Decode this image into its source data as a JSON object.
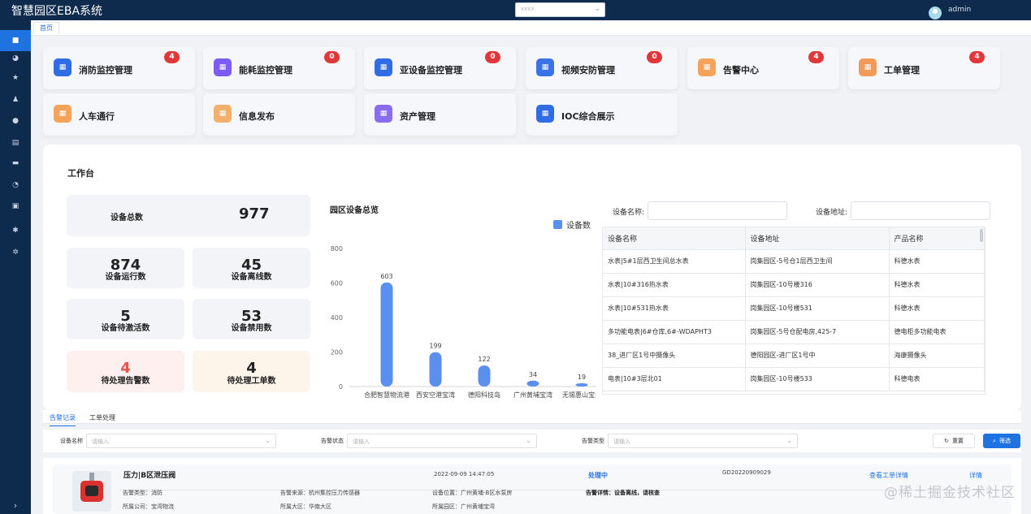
{
  "app": {
    "title": "智慧园区EBA系统",
    "project_select": {
      "placeholder": "xxxx"
    },
    "user": "admin"
  },
  "tabs": {
    "home": "首页"
  },
  "sidebar": {
    "items": [
      "dashboard",
      "monitor",
      "favorite",
      "user",
      "bell",
      "document",
      "print",
      "report",
      "module",
      "settings",
      "gear"
    ]
  },
  "modules": [
    {
      "label": "消防监控管理",
      "badge": "4",
      "color": "#2f6ce5",
      "icon": "fire-monitor-icon"
    },
    {
      "label": "能耗监控管理",
      "badge": "0",
      "color": "#7b5cf5",
      "icon": "energy-icon"
    },
    {
      "label": "亚设备监控管理",
      "badge": "0",
      "color": "#2f6ce5",
      "icon": "sub-device-icon"
    },
    {
      "label": "视频安防管理",
      "badge": "0",
      "color": "#3a72e8",
      "icon": "video-security-icon"
    },
    {
      "label": "告警中心",
      "badge": "4",
      "color": "#f5a35b",
      "icon": "alarm-center-icon"
    },
    {
      "label": "工单管理",
      "badge": "4",
      "color": "#f29a5a",
      "icon": "work-order-icon"
    },
    {
      "label": "人车通行",
      "badge": "",
      "color": "#f5a35b",
      "icon": "vehicle-pass-icon"
    },
    {
      "label": "信息发布",
      "badge": "",
      "color": "#f2b06a",
      "icon": "info-publish-icon"
    },
    {
      "label": "资产管理",
      "badge": "",
      "color": "#8a6cf3",
      "icon": "asset-icon"
    },
    {
      "label": "IOC综合展示",
      "badge": "",
      "color": "#2f6ce5",
      "icon": "ioc-icon"
    }
  ],
  "workbench": {
    "title": "工作台",
    "total": {
      "label": "设备总数",
      "value": "977"
    },
    "stats": [
      {
        "value": "874",
        "label": "设备运行数",
        "tone": "neutral"
      },
      {
        "value": "45",
        "label": "设备离线数",
        "tone": "neutral"
      },
      {
        "value": "5",
        "label": "设备待激活数",
        "tone": "neutral"
      },
      {
        "value": "53",
        "label": "设备禁用数",
        "tone": "neutral"
      },
      {
        "value": "4",
        "label": "待处理告警数",
        "tone": "alert"
      },
      {
        "value": "4",
        "label": "待处理工单数",
        "tone": "warm"
      }
    ]
  },
  "chart_data": {
    "type": "bar",
    "title": "园区设备总览",
    "legend": "设备数",
    "categories": [
      "合肥智慧物流港",
      "西安空港宝湾",
      "德阳科技岛",
      "广州黄埔宝湾",
      "无锡惠山宝湾"
    ],
    "series": [
      {
        "name": "设备数",
        "values": [
          603,
          199,
          122,
          34,
          19
        ]
      }
    ],
    "ylim": [
      0,
      800
    ],
    "yticks": [
      0,
      200,
      400,
      600,
      800
    ],
    "color": "#5a8ff0"
  },
  "device_search": {
    "name_label": "设备名称:",
    "address_label": "设备地址:"
  },
  "device_table": {
    "columns": [
      "设备名称",
      "设备地址",
      "产品名称"
    ],
    "rows": [
      [
        "水表|5#1层西卫生间总水表",
        "岗集园区-5号仓1层西卫生间",
        "科德水表"
      ],
      [
        "水表|10#316热水表",
        "岗集园区-10号楼316",
        "科德水表"
      ],
      [
        "水表|10#531热水表",
        "岗集园区-10号楼531",
        "科德水表"
      ],
      [
        "多功能电表|6#仓库,6#-WDAPHT3",
        "岗集园区-5号仓配电房,425-7",
        "德电柜多功能电表"
      ],
      [
        "38_进厂区1号中摄像头",
        "德阳园区-进厂区1号中",
        "海康摄像头"
      ],
      [
        "电表|10#3层北01",
        "岗集园区-10号楼533",
        "科德电表"
      ]
    ]
  },
  "alarm": {
    "tabs": [
      "告警记录",
      "工单处理"
    ],
    "filters": [
      {
        "label": "设备名称",
        "placeholder": "请输入"
      },
      {
        "label": "告警状态",
        "placeholder": "请输入"
      },
      {
        "label": "告警类型",
        "placeholder": "请输入"
      }
    ],
    "reset": "重置",
    "filter": "筛选",
    "record": {
      "title": "压力|B区泄压阀",
      "time": "2022-09-09 14:47:05",
      "status": "处理中",
      "order_no": "GD20220909029",
      "view_order": "查看工单详情",
      "detail": "详情",
      "alarm_type": "告警类型：消防",
      "alarm_source": "告警来源：杭州集控压力传感器",
      "location": "设备位置：广州黄埔-B区水泵房",
      "alarm_detail": "告警详情：设备离线，请核查",
      "company": "所属公司：宝湾物流",
      "region": "所属大区：华南大区",
      "park": "所属园区：广州黄埔宝湾"
    }
  },
  "watermark": "@稀土掘金技术社区"
}
